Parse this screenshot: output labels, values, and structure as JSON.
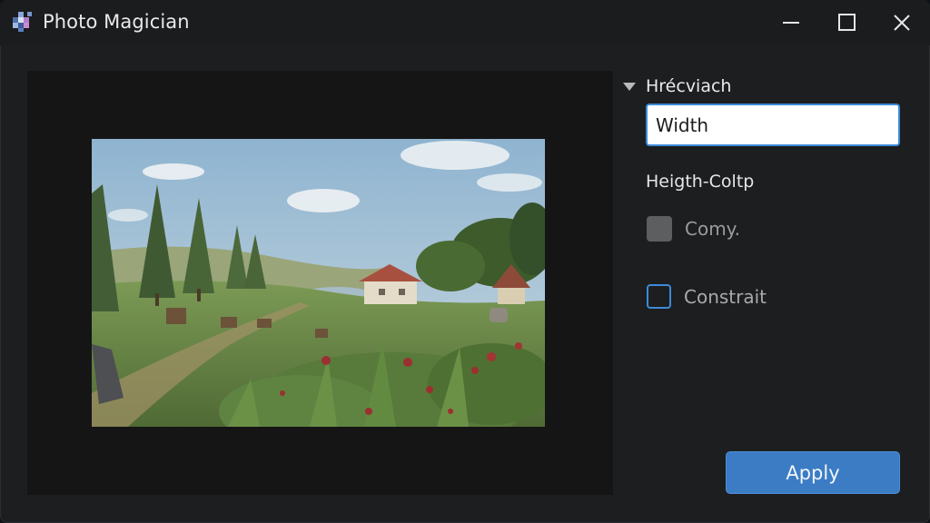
{
  "window": {
    "title": "Photo Magician",
    "app_icon": "pixel-grid-app-icon",
    "controls": [
      "minimize-icon",
      "maximize-icon",
      "close-icon"
    ]
  },
  "canvas": {
    "image": "rural landscape with farmhouse, pond, trees and meadow flowers"
  },
  "panel": {
    "section_title": "Hrécviach",
    "width_input": {
      "value": "Width",
      "placeholder": ""
    },
    "height_label": "Heigth-Coltp",
    "checkbox_comy": {
      "label": "Comy.",
      "checked": false,
      "disabled": true
    },
    "checkbox_constrait": {
      "label": "Constrait",
      "checked": false
    }
  },
  "footer": {
    "apply_label": "Apply"
  },
  "colors": {
    "accent": "#3b7cc5",
    "focus_border": "#3c8bd9",
    "window_bg": "#1d1e20",
    "canvas_bg": "#151515"
  }
}
